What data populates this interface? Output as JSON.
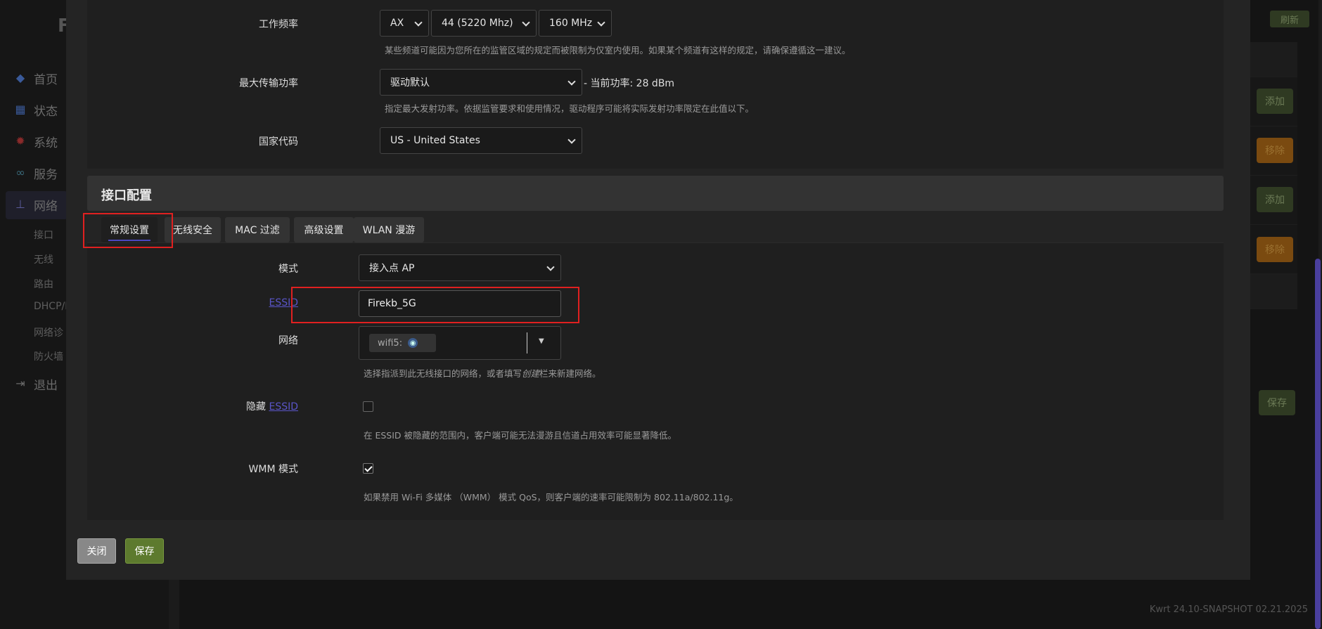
{
  "background": {
    "brand": "F",
    "nav": [
      {
        "label": "首页",
        "icon": "cube-icon"
      },
      {
        "label": "状态",
        "icon": "dashboard-icon"
      },
      {
        "label": "系统",
        "icon": "gear-icon"
      },
      {
        "label": "服务",
        "icon": "link-icon"
      },
      {
        "label": "网络",
        "icon": "network-icon"
      },
      {
        "label": "退出",
        "icon": "logout-icon"
      }
    ],
    "subnav": [
      "接口",
      "无线",
      "路由",
      "DHCP/D",
      "网络诊",
      "防火墙"
    ],
    "refresh_label": "刷新",
    "add_label": "添加",
    "remove_label": "移除",
    "save_label": "保存",
    "version": "Kwrt 24.10-SNAPSHOT 02.21.2025"
  },
  "device_config": {
    "freq_label": "工作频率",
    "freq_mode": "AX",
    "freq_channel": "44 (5220 Mhz)",
    "freq_width": "160 MHz",
    "freq_help": "某些频道可能因为您所在的监管区域的规定而被限制为仅室内使用。如果某个频道有这样的规定，请确保遵循这一建议。",
    "txpower_label": "最大传输功率",
    "txpower_value": "驱动默认",
    "txpower_current": "- 当前功率: 28 dBm",
    "txpower_help": "指定最大发射功率。依据监管要求和使用情况，驱动程序可能将实际发射功率限定在此值以下。",
    "country_label": "国家代码",
    "country_value": "US - United States"
  },
  "iface_config": {
    "title": "接口配置",
    "tabs": [
      "常规设置",
      "无线安全",
      "MAC 过滤",
      "高级设置",
      "WLAN 漫游"
    ],
    "mode_label": "模式",
    "mode_value": "接入点 AP",
    "essid_label": "ESSID",
    "essid_value": "Firekb_5G",
    "network_label": "网络",
    "network_chip": "wifi5:",
    "network_help_pre": "选择指派到此无线接口的网络，或者填写",
    "network_help_em": "创建",
    "network_help_post": "栏来新建网络。",
    "hidden_label_pre": "隐藏",
    "hidden_label_link": "ESSID",
    "hidden_help": "在 ESSID 被隐藏的范围内，客户端可能无法漫游且信道占用效率可能显著降低。",
    "wmm_label": "WMM 模式",
    "wmm_help": "如果禁用 Wi-Fi 多媒体 （WMM） 模式 QoS，则客户端的速率可能限制为 802.11a/802.11g。"
  },
  "actions": {
    "close_label": "关闭",
    "save_label": "保存"
  }
}
